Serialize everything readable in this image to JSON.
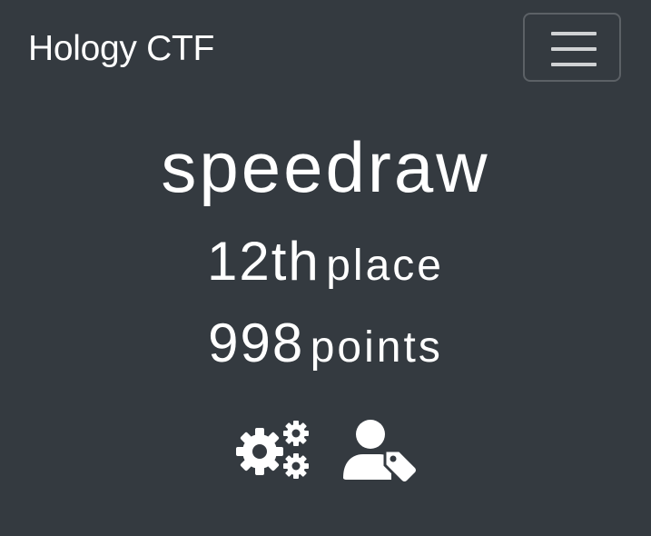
{
  "navbar": {
    "brand": "Hology CTF",
    "toggler_icon": "hamburger-menu-icon"
  },
  "team": {
    "name": "speedraw",
    "place_number": "12th",
    "place_label": "place",
    "points_number": "998",
    "points_label": "points"
  },
  "icons": {
    "settings": "cogs-icon",
    "user_tag": "user-tag-icon"
  },
  "colors": {
    "background": "#343a40",
    "text": "#ffffff",
    "toggler_border": "#5c6166"
  }
}
